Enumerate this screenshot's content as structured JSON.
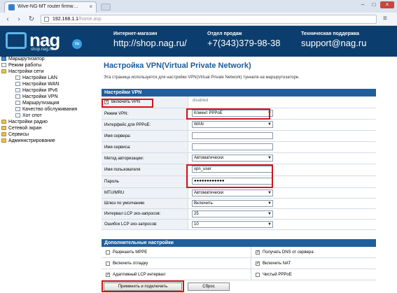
{
  "browser": {
    "tab_title": "Wive-NG-MT router firmw…",
    "tab_close": "×",
    "url_host": "192.168.1.1",
    "url_path": "/home.asp",
    "window_buttons": [
      "–",
      "□",
      "×"
    ],
    "nav": {
      "back": "‹",
      "forward": "›",
      "reload": "↻",
      "menu": "≡"
    }
  },
  "banner": {
    "logo_text": "nag",
    "logo_domain": "shop.nag.ru",
    "logo_badge": "ru",
    "columns": [
      {
        "label": "Интернет-магазин",
        "value": "http://shop.nag.ru/"
      },
      {
        "label": "Отдел продаж",
        "value": "+7(343)379-98-38"
      },
      {
        "label": "Техническая поддержка",
        "value": "support@nag.ru"
      }
    ]
  },
  "sidebar": {
    "items": [
      {
        "label": "Маршрутизатор"
      },
      {
        "label": "Режим работы"
      },
      {
        "label": "Настройки сети"
      },
      {
        "label": "Настройки LAN"
      },
      {
        "label": "Настройки WAN"
      },
      {
        "label": "Настройки IPv6"
      },
      {
        "label": "Настройки VPN"
      },
      {
        "label": "Маршрутизация"
      },
      {
        "label": "Качество обслуживания"
      },
      {
        "label": "Хот спот"
      },
      {
        "label": "Настройки радио"
      },
      {
        "label": "Сетевой экран"
      },
      {
        "label": "Сервисы"
      },
      {
        "label": "Администрирование"
      }
    ]
  },
  "main": {
    "title": "Настройка VPN(Virtual Private Network)",
    "description": "Эта страница используется для настройки VPN(Virtual Private Network) туннеля на маршрутизаторе.",
    "vpn_section": {
      "heading": "Настройки VPN",
      "enable_label": "Включить VPN",
      "enable_checked": "✓",
      "status": "disabled",
      "rows": [
        {
          "label": "Режим VPN:",
          "value": "Клиент PPPoE",
          "kind": "select"
        },
        {
          "label": "Интерфейс для PPPoE:",
          "value": "WAN",
          "kind": "select"
        },
        {
          "label": "Имя сервера:",
          "value": "",
          "kind": "text"
        },
        {
          "label": "Имя сервиса:",
          "value": "",
          "kind": "text"
        },
        {
          "label": "Метод авторизации:",
          "value": "Автоматически",
          "kind": "select"
        },
        {
          "label": "Имя пользователя",
          "value": "vpn_user",
          "kind": "text"
        },
        {
          "label": "Пароль",
          "value": "●●●●●●●●●●●●",
          "kind": "text"
        },
        {
          "label": "MTU/MRU",
          "value": "Автоматически",
          "kind": "select"
        },
        {
          "label": "Шлюз по умолчанию",
          "value": "Включить",
          "kind": "select"
        },
        {
          "label": "Интервал LCP эхо-запросов:",
          "value": "25",
          "kind": "select"
        },
        {
          "label": "Ошибок LCP эхо-запросов:",
          "value": "10",
          "kind": "select"
        }
      ]
    },
    "advanced_section": {
      "heading": "Дополнительные настройки",
      "rows": [
        {
          "left": "Разрешить MPPE",
          "left_checked": "",
          "right": "Получать DNS от сервера",
          "right_checked": "✓"
        },
        {
          "left": "Включить отладку",
          "left_checked": "",
          "right": "Включить NAT",
          "right_checked": "✓"
        },
        {
          "left": "Адаптивный LCP интервал",
          "left_checked": "✓",
          "right": "Чистый PPPoE",
          "right_checked": ""
        }
      ]
    },
    "buttons": {
      "apply": "Применить и подключить",
      "reset": "Сброс"
    }
  },
  "colors": {
    "banner_bg": "#0b3e6e",
    "section_head": "#215e9b",
    "title": "#1b5a9a",
    "highlight": "#d6141b"
  }
}
